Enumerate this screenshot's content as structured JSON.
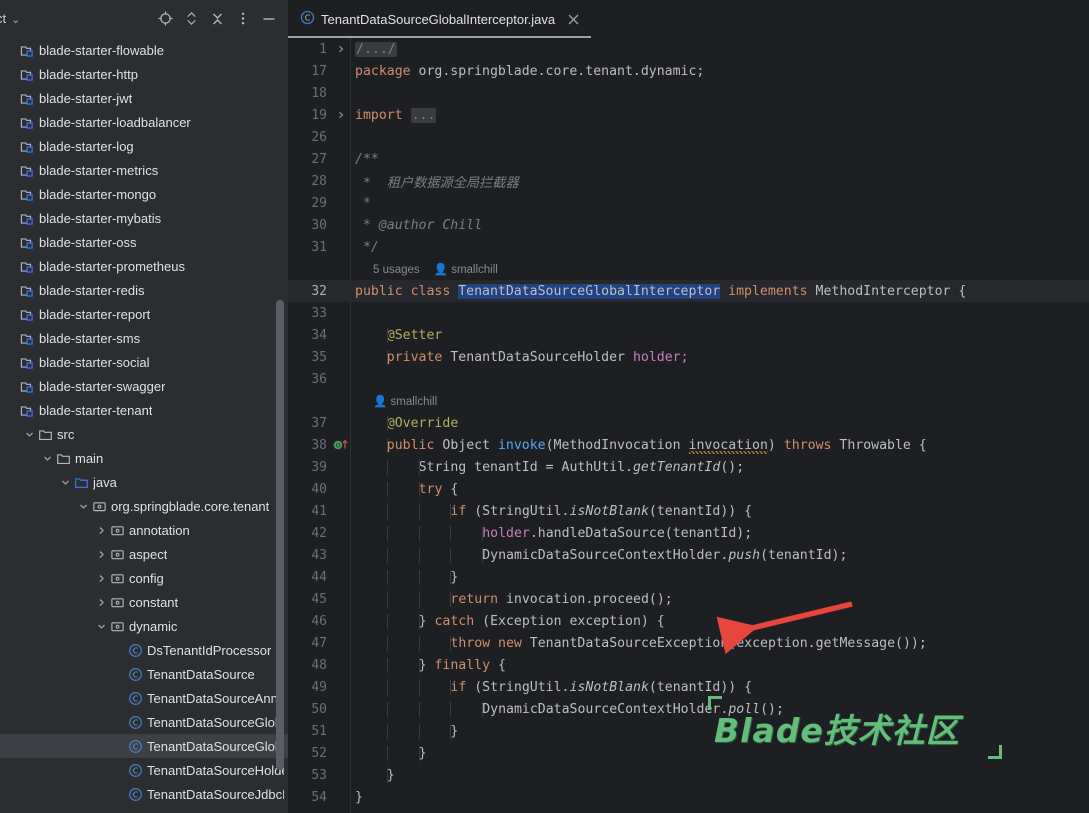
{
  "window": {
    "bg_color": "#1E1F22",
    "sidebar_color": "#2B2D30",
    "accent_selection": "#214283"
  },
  "sidebar": {
    "title": "ct",
    "title_chevron": "⌄",
    "toolbar": [
      {
        "name": "select-opened-file-icon",
        "label": "Select Opened File"
      },
      {
        "name": "expand-collapse-icon",
        "label": "Expand / Collapse"
      },
      {
        "name": "collapse-all-icon",
        "label": "Collapse All"
      },
      {
        "name": "more-options-icon",
        "label": "Options"
      },
      {
        "name": "hide-panel-icon",
        "label": "Hide"
      }
    ],
    "tree": [
      {
        "label": "blade-starter-flowable",
        "icon": "module",
        "indent": 0,
        "arrow": "",
        "selected": false
      },
      {
        "label": "blade-starter-http",
        "icon": "module",
        "indent": 0,
        "arrow": "",
        "selected": false
      },
      {
        "label": "blade-starter-jwt",
        "icon": "module",
        "indent": 0,
        "arrow": "",
        "selected": false
      },
      {
        "label": "blade-starter-loadbalancer",
        "icon": "module",
        "indent": 0,
        "arrow": "",
        "selected": false
      },
      {
        "label": "blade-starter-log",
        "icon": "module",
        "indent": 0,
        "arrow": "",
        "selected": false
      },
      {
        "label": "blade-starter-metrics",
        "icon": "module",
        "indent": 0,
        "arrow": "",
        "selected": false
      },
      {
        "label": "blade-starter-mongo",
        "icon": "module",
        "indent": 0,
        "arrow": "",
        "selected": false
      },
      {
        "label": "blade-starter-mybatis",
        "icon": "module",
        "indent": 0,
        "arrow": "",
        "selected": false
      },
      {
        "label": "blade-starter-oss",
        "icon": "module",
        "indent": 0,
        "arrow": "",
        "selected": false
      },
      {
        "label": "blade-starter-prometheus",
        "icon": "module",
        "indent": 0,
        "arrow": "",
        "selected": false
      },
      {
        "label": "blade-starter-redis",
        "icon": "module",
        "indent": 0,
        "arrow": "",
        "selected": false
      },
      {
        "label": "blade-starter-report",
        "icon": "module",
        "indent": 0,
        "arrow": "",
        "selected": false
      },
      {
        "label": "blade-starter-sms",
        "icon": "module",
        "indent": 0,
        "arrow": "",
        "selected": false
      },
      {
        "label": "blade-starter-social",
        "icon": "module",
        "indent": 0,
        "arrow": "",
        "selected": false
      },
      {
        "label": "blade-starter-swagger",
        "icon": "module",
        "indent": 0,
        "arrow": "",
        "selected": false
      },
      {
        "label": "blade-starter-tenant",
        "icon": "module",
        "indent": 0,
        "arrow": "",
        "selected": false
      },
      {
        "label": "src",
        "icon": "folder",
        "indent": 1,
        "arrow": "down",
        "selected": false
      },
      {
        "label": "main",
        "icon": "folder",
        "indent": 2,
        "arrow": "down",
        "selected": false
      },
      {
        "label": "java",
        "icon": "source-folder",
        "indent": 3,
        "arrow": "down",
        "selected": false
      },
      {
        "label": "org.springblade.core.tenant",
        "icon": "package",
        "indent": 4,
        "arrow": "down",
        "selected": false
      },
      {
        "label": "annotation",
        "icon": "package",
        "indent": 5,
        "arrow": "right",
        "selected": false
      },
      {
        "label": "aspect",
        "icon": "package",
        "indent": 5,
        "arrow": "right",
        "selected": false
      },
      {
        "label": "config",
        "icon": "package",
        "indent": 5,
        "arrow": "right",
        "selected": false
      },
      {
        "label": "constant",
        "icon": "package",
        "indent": 5,
        "arrow": "right",
        "selected": false
      },
      {
        "label": "dynamic",
        "icon": "package",
        "indent": 5,
        "arrow": "down",
        "selected": false
      },
      {
        "label": "DsTenantIdProcessor",
        "icon": "class",
        "indent": 6,
        "arrow": "",
        "selected": false
      },
      {
        "label": "TenantDataSource",
        "icon": "class",
        "indent": 6,
        "arrow": "",
        "selected": false
      },
      {
        "label": "TenantDataSourceAnno",
        "icon": "class",
        "indent": 6,
        "arrow": "",
        "selected": false
      },
      {
        "label": "TenantDataSourceGloba",
        "icon": "class",
        "indent": 6,
        "arrow": "",
        "selected": false
      },
      {
        "label": "TenantDataSourceGloba",
        "icon": "class",
        "indent": 6,
        "arrow": "",
        "selected": true
      },
      {
        "label": "TenantDataSourceHolde",
        "icon": "class",
        "indent": 6,
        "arrow": "",
        "selected": false
      },
      {
        "label": "TenantDataSourceJdbcF",
        "icon": "class",
        "indent": 6,
        "arrow": "",
        "selected": false
      }
    ]
  },
  "editor": {
    "tab": {
      "icon": "java-class-icon",
      "label": "TenantDataSourceGlobalInterceptor.java",
      "close_label": "×"
    },
    "hints": {
      "usages": "5 usages",
      "author": "smallchill"
    },
    "lines": [
      {
        "num": "1",
        "fold": "right",
        "caret": false
      },
      {
        "num": "17",
        "fold": "",
        "caret": false
      },
      {
        "num": "18",
        "fold": "",
        "caret": false
      },
      {
        "num": "19",
        "fold": "right",
        "caret": false
      },
      {
        "num": "26",
        "fold": "",
        "caret": false
      },
      {
        "num": "27",
        "fold": "",
        "caret": false
      },
      {
        "num": "28",
        "fold": "",
        "caret": false
      },
      {
        "num": "29",
        "fold": "",
        "caret": false
      },
      {
        "num": "30",
        "fold": "",
        "caret": false
      },
      {
        "num": "31",
        "fold": "",
        "caret": false
      },
      {
        "num": "32",
        "fold": "",
        "caret": true
      },
      {
        "num": "33",
        "fold": "",
        "caret": false
      },
      {
        "num": "34",
        "fold": "",
        "caret": false
      },
      {
        "num": "35",
        "fold": "",
        "caret": false
      },
      {
        "num": "36",
        "fold": "",
        "caret": false
      },
      {
        "num": "37",
        "fold": "",
        "caret": false
      },
      {
        "num": "38",
        "fold": "",
        "caret": false
      },
      {
        "num": "39",
        "fold": "",
        "caret": false
      },
      {
        "num": "40",
        "fold": "",
        "caret": false
      },
      {
        "num": "41",
        "fold": "",
        "caret": false
      },
      {
        "num": "42",
        "fold": "",
        "caret": false
      },
      {
        "num": "43",
        "fold": "",
        "caret": false
      },
      {
        "num": "44",
        "fold": "",
        "caret": false
      },
      {
        "num": "45",
        "fold": "",
        "caret": false
      },
      {
        "num": "46",
        "fold": "",
        "caret": false
      },
      {
        "num": "47",
        "fold": "",
        "caret": false
      },
      {
        "num": "48",
        "fold": "",
        "caret": false
      },
      {
        "num": "49",
        "fold": "",
        "caret": false
      },
      {
        "num": "50",
        "fold": "",
        "caret": false
      },
      {
        "num": "51",
        "fold": "",
        "caret": false
      },
      {
        "num": "52",
        "fold": "",
        "caret": false
      },
      {
        "num": "53",
        "fold": "",
        "caret": false
      },
      {
        "num": "54",
        "fold": "",
        "caret": false
      }
    ],
    "code": {
      "l1_fold": "/.../",
      "l17": "package org.springblade.core.tenant.dynamic;",
      "l19_kw": "import",
      "l19_fold": "...",
      "l27": "/**",
      "l28": " *  租户数据源全局拦截器",
      "l29": " *",
      "l30": " * @author Chill",
      "l31": " */",
      "l32_a": "public class ",
      "l32_sel": "TenantDataSourceGlobalInterceptor",
      "l32_b": " implements ",
      "l32_c": "MethodInterceptor {",
      "l34": "@Setter",
      "l35_kw": "private ",
      "l35_t": "TenantDataSourceHolder ",
      "l35_f": "holder;",
      "l37": "@Override",
      "l38_a": "public ",
      "l38_t": "Object ",
      "l38_m": "invoke",
      "l38_b": "(MethodInvocation ",
      "l38_p": "invocation",
      "l38_c": ") ",
      "l38_kw2": "throws ",
      "l38_d": "Throwable {",
      "l39_a": "String tenantId = AuthUtil.",
      "l39_m": "getTenantId",
      "l39_b": "();",
      "l40_kw": "try",
      "l40_b": " {",
      "l41_kw": "if",
      "l41_a": " (StringUtil.",
      "l41_m": "isNotBlank",
      "l41_b": "(tenantId)) {",
      "l42_f": "holder",
      "l42_b": ".handleDataSource(tenantId);",
      "l43_a": "DynamicDataSourceContextHolder.",
      "l43_m": "push",
      "l43_b": "(tenantId);",
      "l44": "}",
      "l45_kw": "return",
      "l45_b": " invocation.proceed();",
      "l46_a": "} ",
      "l46_kw": "catch",
      "l46_b": " (Exception exception) {",
      "l47_kw": "throw new ",
      "l47_b": "TenantDataSourceException(exception.getMessage());",
      "l48_a": "} ",
      "l48_kw": "finally",
      "l48_b": " {",
      "l49_kw": "if",
      "l49_a": " (StringUtil.",
      "l49_m": "isNotBlank",
      "l49_b": "(tenantId)) {",
      "l50_a": "DynamicDataSourceContextHolder.",
      "l50_m": "poll",
      "l50_b": "();",
      "l51": "}",
      "l52": "}",
      "l53": "}",
      "l54": "}"
    }
  },
  "annotations": {
    "arrow": {
      "name": "red-arrow-annotation",
      "color": "#E8453C"
    }
  },
  "watermark": {
    "text": "Blade技术社区",
    "color": "#63BE7B"
  }
}
